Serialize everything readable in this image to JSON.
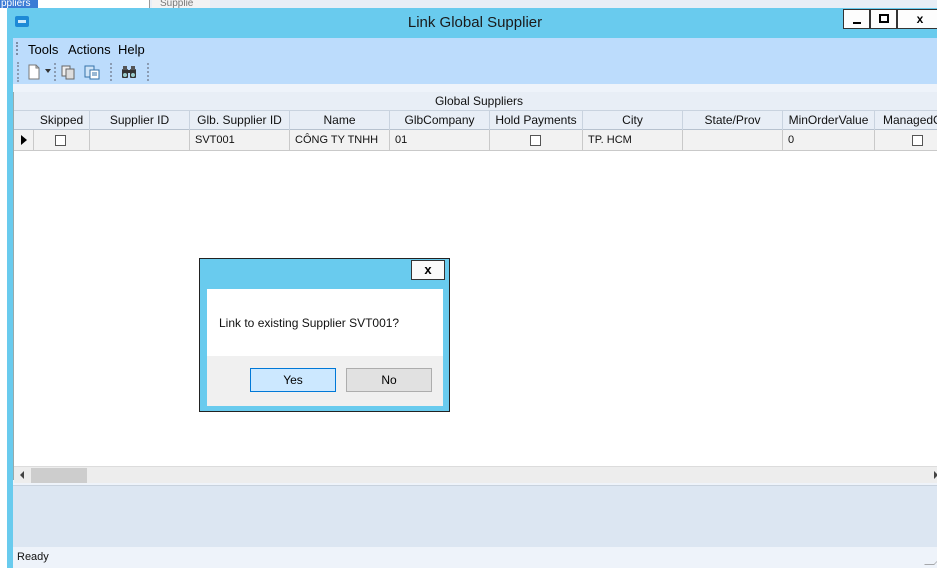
{
  "background_window": {
    "tab_label": "ppliers",
    "tab2_label": "Supplie"
  },
  "window": {
    "title": "Link Global Supplier",
    "controls": {
      "minimize": "—",
      "maximize": "☐",
      "close": "x"
    },
    "app_icon": "app-icon"
  },
  "menu": {
    "items": [
      "Tools",
      "Actions",
      "Help"
    ]
  },
  "toolbar": {
    "icons": [
      "new-document-icon",
      "dropdown-caret-icon",
      "copy-icon",
      "paste-icon",
      "find-binoculars-icon"
    ]
  },
  "grid": {
    "caption": "Global Suppliers",
    "columns": [
      "Skipped",
      "Supplier ID",
      "Glb. Supplier ID",
      "Name",
      "GlbCompany",
      "Hold Payments",
      "City",
      "State/Prov",
      "MinOrderValue",
      "ManagedC"
    ],
    "rows": [
      {
        "skipped": false,
        "supplier_id": "",
        "glb_supplier_id": "SVT001",
        "name": "CÔNG TY TNHH",
        "glb_company": "01",
        "hold_payments": false,
        "city": "TP. HCM",
        "state_prov": "",
        "min_order_value": "0",
        "managed": false
      }
    ]
  },
  "status": {
    "text": "Ready"
  },
  "dialog": {
    "close_label": "x",
    "message": "Link to existing Supplier SVT001?",
    "yes_label": "Yes",
    "no_label": "No"
  },
  "colors": {
    "window_frame": "#69cbee",
    "menu_bg": "#bcdcfc",
    "grid_header_bg": "#e8eef6",
    "primary_button_border": "#0078d7"
  }
}
